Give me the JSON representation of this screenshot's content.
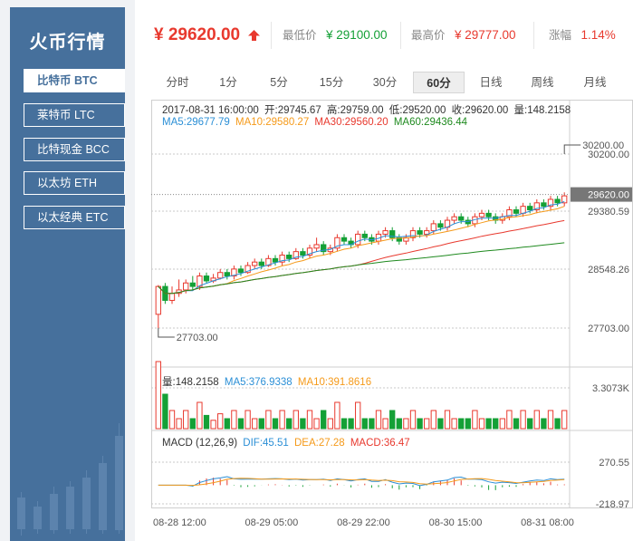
{
  "app": {
    "title": "火币行情"
  },
  "coins": [
    {
      "label": "比特币 BTC",
      "active": true
    },
    {
      "label": "莱特币 LTC",
      "active": false
    },
    {
      "label": "比特现金 BCC",
      "active": false
    },
    {
      "label": "以太坊 ETH",
      "active": false
    },
    {
      "label": "以太经典 ETC",
      "active": false
    }
  ],
  "ticker": {
    "price": "¥ 29620.00",
    "low_label": "最低价",
    "low_value": "¥ 29100.00",
    "high_label": "最高价",
    "high_value": "¥ 29777.00",
    "change_label": "涨幅",
    "change_value": "1.14%"
  },
  "tabs": [
    {
      "label": "分时",
      "active": false
    },
    {
      "label": "1分",
      "active": false
    },
    {
      "label": "5分",
      "active": false
    },
    {
      "label": "15分",
      "active": false
    },
    {
      "label": "30分",
      "active": false
    },
    {
      "label": "60分",
      "active": true
    },
    {
      "label": "日线",
      "active": false
    },
    {
      "label": "周线",
      "active": false
    },
    {
      "label": "月线",
      "active": false
    }
  ],
  "info": {
    "time": "2017-08-31 16:00:00",
    "open": "开:29745.67",
    "high": "高:29759.00",
    "low": "低:29520.00",
    "close": "收:29620.00",
    "vol": "量:148.2158",
    "ma5": "MA5:29677.79",
    "ma10": "MA10:29580.27",
    "ma30": "MA30:29560.20",
    "ma60": "MA60:29436.44"
  },
  "vol_info": {
    "vol": "量:148.2158",
    "ma5": "MA5:376.9338",
    "ma10": "MA10:391.8616"
  },
  "macd_info": {
    "label": "MACD (12,26,9)",
    "dif": "DIF:45.51",
    "dea": "DEA:27.28",
    "macd": "MACD:36.47"
  },
  "colors": {
    "up": "#e8392e",
    "down": "#14a036",
    "ma5": "#2b8fd6",
    "ma10": "#f59a1a",
    "ma30": "#e8392e",
    "ma60": "#1f8a1f",
    "sidebar": "#46709c"
  },
  "chart_data": {
    "type": "candlestick",
    "y_ticks": [
      "30200.00",
      "29380.59",
      "28548.26",
      "27703.00"
    ],
    "y_range": [
      27703,
      30200
    ],
    "current_price_label": "29620.00",
    "max_annotation": "30200.00",
    "min_annotation": "27703.00",
    "vol_ticks": [
      "3.3073K"
    ],
    "vol_range": [
      0,
      3307.3
    ],
    "macd_ticks": [
      "270.55",
      "-218.97"
    ],
    "macd_range": [
      -218.97,
      270.55
    ],
    "x_ticks": [
      "08-28 12:00",
      "08-29 05:00",
      "08-29 22:00",
      "08-30 15:00",
      "08-31 08:00"
    ],
    "candles": [
      [
        27900,
        28300,
        27703,
        28320
      ],
      [
        28300,
        28100,
        28050,
        28350
      ],
      [
        28100,
        28200,
        28050,
        28300
      ],
      [
        28200,
        28250,
        28150,
        28400
      ],
      [
        28250,
        28350,
        28200,
        28400
      ],
      [
        28350,
        28300,
        28250,
        28450
      ],
      [
        28300,
        28450,
        28250,
        28500
      ],
      [
        28450,
        28380,
        28350,
        28500
      ],
      [
        28380,
        28420,
        28350,
        28480
      ],
      [
        28420,
        28500,
        28400,
        28550
      ],
      [
        28500,
        28450,
        28400,
        28550
      ],
      [
        28450,
        28550,
        28400,
        28600
      ],
      [
        28550,
        28500,
        28450,
        28600
      ],
      [
        28500,
        28600,
        28480,
        28650
      ],
      [
        28600,
        28650,
        28550,
        28700
      ],
      [
        28650,
        28600,
        28550,
        28700
      ],
      [
        28600,
        28700,
        28580,
        28750
      ],
      [
        28700,
        28650,
        28600,
        28750
      ],
      [
        28650,
        28750,
        28600,
        28800
      ],
      [
        28750,
        28700,
        28650,
        28800
      ],
      [
        28700,
        28800,
        28680,
        28850
      ],
      [
        28800,
        28750,
        28700,
        28850
      ],
      [
        28750,
        28850,
        28700,
        28900
      ],
      [
        28850,
        28900,
        28800,
        29000
      ],
      [
        28900,
        28800,
        28750,
        28950
      ],
      [
        28800,
        28850,
        28750,
        28900
      ],
      [
        28850,
        29000,
        28800,
        29050
      ],
      [
        29000,
        28950,
        28900,
        29050
      ],
      [
        28950,
        28900,
        28850,
        29000
      ],
      [
        28900,
        29050,
        28850,
        29100
      ],
      [
        29050,
        29000,
        28950,
        29100
      ],
      [
        29000,
        28950,
        28900,
        29050
      ],
      [
        28950,
        29050,
        28900,
        29100
      ],
      [
        29050,
        29100,
        29000,
        29150
      ],
      [
        29100,
        29000,
        28950,
        29150
      ],
      [
        29000,
        28950,
        28900,
        29050
      ],
      [
        28950,
        29000,
        28900,
        29050
      ],
      [
        29000,
        29100,
        28950,
        29150
      ],
      [
        29100,
        29050,
        29000,
        29150
      ],
      [
        29050,
        29100,
        29000,
        29150
      ],
      [
        29100,
        29200,
        29050,
        29250
      ],
      [
        29200,
        29150,
        29100,
        29250
      ],
      [
        29150,
        29250,
        29100,
        29300
      ],
      [
        29250,
        29300,
        29200,
        29350
      ],
      [
        29300,
        29250,
        29200,
        29350
      ],
      [
        29250,
        29200,
        29150,
        29300
      ],
      [
        29200,
        29300,
        29150,
        29350
      ],
      [
        29300,
        29350,
        29250,
        29400
      ],
      [
        29350,
        29300,
        29250,
        29400
      ],
      [
        29300,
        29250,
        29200,
        29350
      ],
      [
        29250,
        29300,
        29200,
        29350
      ],
      [
        29300,
        29400,
        29250,
        29450
      ],
      [
        29400,
        29350,
        29300,
        29450
      ],
      [
        29350,
        29450,
        29300,
        29500
      ],
      [
        29450,
        29400,
        29350,
        29500
      ],
      [
        29400,
        29500,
        29350,
        29550
      ],
      [
        29500,
        29450,
        29400,
        29550
      ],
      [
        29450,
        29550,
        29400,
        29600
      ],
      [
        29550,
        29500,
        29450,
        29600
      ],
      [
        29500,
        29600,
        29450,
        29650
      ]
    ]
  }
}
